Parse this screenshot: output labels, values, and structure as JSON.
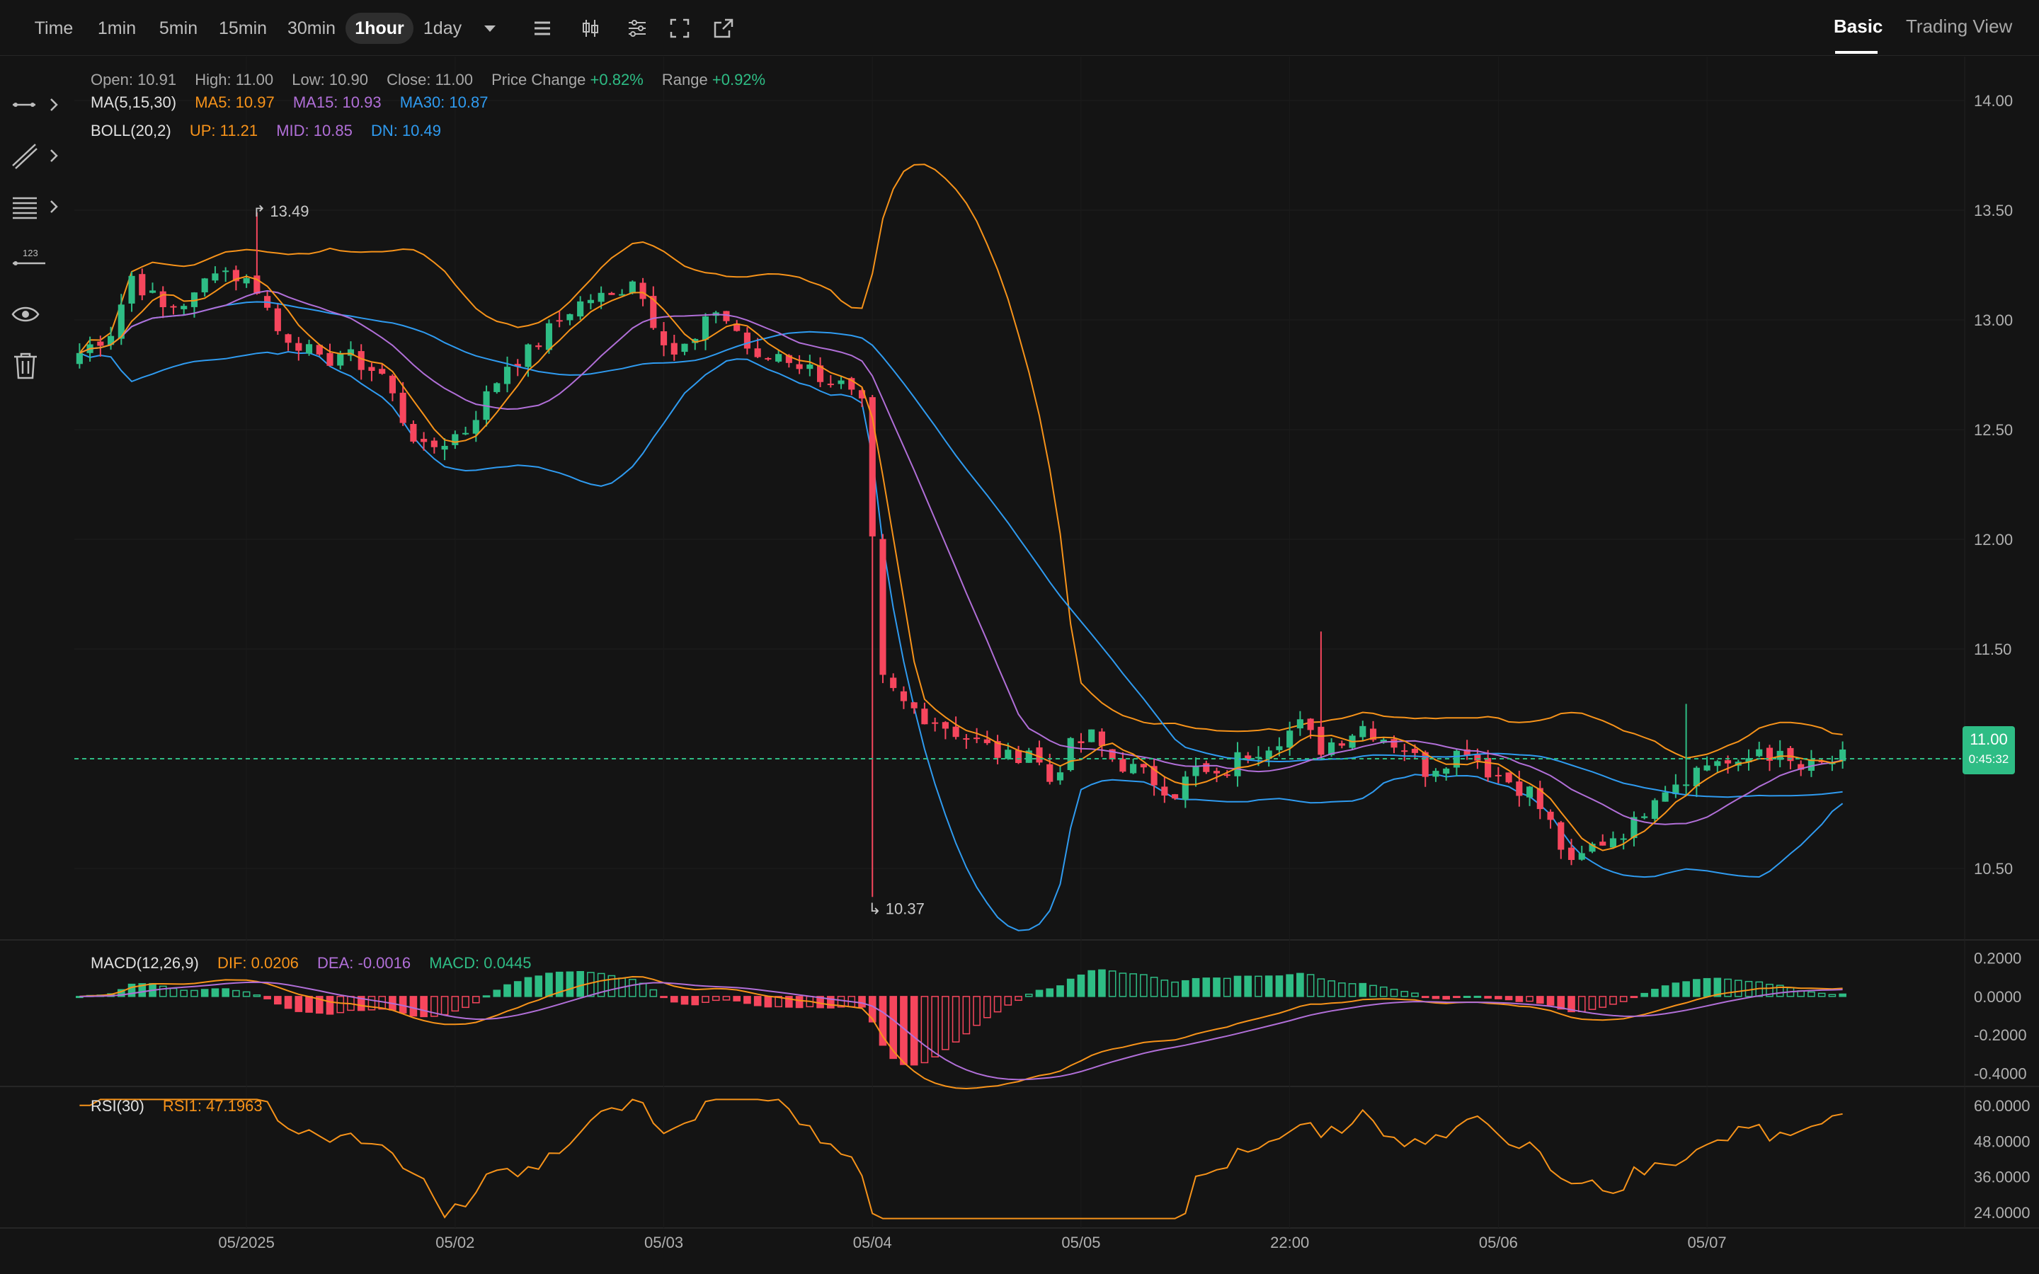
{
  "timeframes": [
    "Time",
    "1min",
    "5min",
    "15min",
    "30min",
    "1hour",
    "1day"
  ],
  "active_timeframe": "1hour",
  "view_tabs": {
    "basic": "Basic",
    "trading_view": "Trading View"
  },
  "ohlc": {
    "open_label": "Open:",
    "open": "10.91",
    "high_label": "High:",
    "high": "11.00",
    "low_label": "Low:",
    "low": "10.90",
    "close_label": "Close:",
    "close": "11.00",
    "change_label": "Price Change",
    "change": "+0.82%",
    "range_label": "Range",
    "range": "+0.92%"
  },
  "ma": {
    "name": "MA(5,15,30)",
    "ma5": "MA5: 10.97",
    "ma15": "MA15: 10.93",
    "ma30": "MA30: 10.87"
  },
  "boll": {
    "name": "BOLL(20,2)",
    "up": "UP: 11.21",
    "mid": "MID: 10.85",
    "dn": "DN: 10.49"
  },
  "macd": {
    "name": "MACD(12,26,9)",
    "dif": "DIF: 0.0206",
    "dea": "DEA: -0.0016",
    "macd": "MACD: 0.0445"
  },
  "rsi": {
    "name": "RSI(30)",
    "rsi1": "RSI1: 47.1963"
  },
  "current_price": "11.00",
  "countdown": "0:45:32",
  "high_marker": "13.49",
  "low_marker": "10.37",
  "colors": {
    "up": "#2ebd85",
    "down": "#f6465d",
    "ma5": "#f7931a",
    "ma15": "#b16fd8",
    "ma30": "#2f9bf0",
    "boll_up": "#f7931a",
    "boll_mid": "#b16fd8",
    "boll_dn": "#2f9bf0",
    "rsi": "#f7931a",
    "bg": "#141414"
  },
  "icons": [
    "line-tool-icon",
    "trend-tool-icon",
    "fib-tool-icon",
    "measure-tool-icon",
    "eye-icon",
    "trash-icon"
  ],
  "chart_data": {
    "type": "candlestick",
    "price_axis": {
      "ticks": [
        "14.00",
        "13.50",
        "13.00",
        "12.50",
        "12.00",
        "11.50",
        "11.00",
        "10.50"
      ],
      "min": 10.2,
      "max": 14.2
    },
    "macd_axis": {
      "ticks": [
        "0.2000",
        "0.0000",
        "-0.2000",
        "-0.4000"
      ],
      "min": -0.45,
      "max": 0.25
    },
    "rsi_axis": {
      "ticks": [
        "60.0000",
        "48.0000",
        "36.0000",
        "24.0000"
      ],
      "min": 20,
      "max": 64
    },
    "x_ticks": [
      "05/2025",
      "05/02",
      "05/03",
      "05/04",
      "05/05",
      "22:00",
      "05/06",
      "05/07"
    ],
    "x_tick_index": [
      16,
      36,
      56,
      76,
      96,
      116,
      136,
      156
    ],
    "anchors": [
      [
        0,
        12.85
      ],
      [
        3,
        12.95
      ],
      [
        5,
        13.2
      ],
      [
        8,
        13.05
      ],
      [
        11,
        13.1
      ],
      [
        13,
        13.25
      ],
      [
        15,
        13.2
      ],
      [
        17,
        13.15
      ],
      [
        19,
        12.95
      ],
      [
        21,
        12.9
      ],
      [
        23,
        12.8
      ],
      [
        25,
        12.85
      ],
      [
        27,
        12.8
      ],
      [
        29,
        12.75
      ],
      [
        31,
        12.55
      ],
      [
        33,
        12.4
      ],
      [
        35,
        12.45
      ],
      [
        37,
        12.5
      ],
      [
        39,
        12.65
      ],
      [
        41,
        12.8
      ],
      [
        43,
        12.85
      ],
      [
        45,
        12.95
      ],
      [
        47,
        13.05
      ],
      [
        49,
        13.1
      ],
      [
        51,
        13.1
      ],
      [
        53,
        13.2
      ],
      [
        55,
        13.0
      ],
      [
        57,
        12.85
      ],
      [
        59,
        12.9
      ],
      [
        61,
        13.05
      ],
      [
        63,
        12.95
      ],
      [
        65,
        12.8
      ],
      [
        67,
        12.85
      ],
      [
        69,
        12.8
      ],
      [
        71,
        12.75
      ],
      [
        73,
        12.7
      ],
      [
        75,
        12.6
      ],
      [
        77,
        11.35
      ],
      [
        79,
        11.25
      ],
      [
        81,
        11.2
      ],
      [
        83,
        11.15
      ],
      [
        85,
        11.1
      ],
      [
        87,
        11.05
      ],
      [
        89,
        11.0
      ],
      [
        91,
        11.05
      ],
      [
        93,
        10.9
      ],
      [
        95,
        11.05
      ],
      [
        97,
        11.1
      ],
      [
        99,
        11.0
      ],
      [
        101,
        10.95
      ],
      [
        103,
        10.9
      ],
      [
        105,
        10.85
      ],
      [
        107,
        10.95
      ],
      [
        109,
        10.9
      ],
      [
        111,
        11.0
      ],
      [
        113,
        11.05
      ],
      [
        115,
        11.1
      ],
      [
        117,
        11.15
      ],
      [
        119,
        11.05
      ],
      [
        121,
        11.1
      ],
      [
        123,
        11.15
      ],
      [
        125,
        11.1
      ],
      [
        127,
        11.05
      ],
      [
        129,
        10.95
      ],
      [
        131,
        11.0
      ],
      [
        133,
        11.05
      ],
      [
        135,
        10.95
      ],
      [
        137,
        10.9
      ],
      [
        139,
        10.85
      ],
      [
        141,
        10.7
      ],
      [
        143,
        10.5
      ],
      [
        145,
        10.6
      ],
      [
        147,
        10.65
      ],
      [
        149,
        10.7
      ],
      [
        151,
        10.85
      ],
      [
        153,
        10.9
      ],
      [
        155,
        10.95
      ],
      [
        157,
        11.0
      ],
      [
        159,
        10.95
      ],
      [
        161,
        11.05
      ],
      [
        163,
        11.0
      ],
      [
        165,
        10.95
      ],
      [
        167,
        10.97
      ],
      [
        169,
        11.0
      ]
    ],
    "spikes": [
      [
        76,
        10.37
      ],
      [
        17,
        13.49
      ],
      [
        119,
        11.58
      ],
      [
        154,
        11.25
      ]
    ]
  }
}
